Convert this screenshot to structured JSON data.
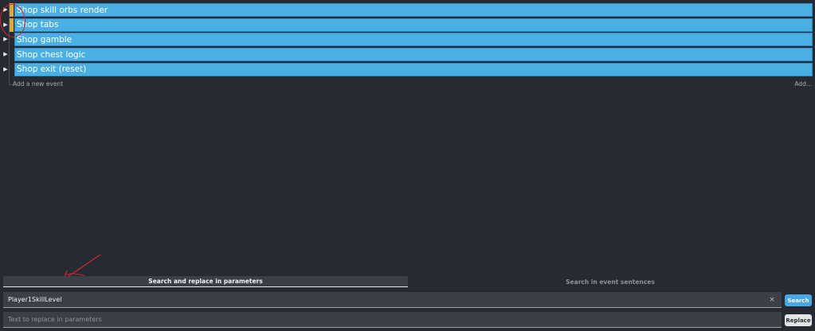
{
  "events": [
    {
      "title": "Shop skill orbs render"
    },
    {
      "title": "Shop tabs"
    },
    {
      "title": "Shop gamble"
    },
    {
      "title": "Shop chest logic"
    },
    {
      "title": "Shop exit (reset)"
    }
  ],
  "add_event": {
    "label": "Add a new event",
    "more_label": "Add..."
  },
  "search_panel": {
    "tabs": [
      {
        "label": "Search and replace in parameters",
        "active": true
      },
      {
        "label": "Search in event sentences",
        "active": false
      }
    ],
    "search_value": "Player1SkillLevel",
    "clear_symbol": "×",
    "search_button": "Search",
    "replace_placeholder": "Text to replace in parameters",
    "replace_button": "Replace"
  },
  "icons": {
    "expand": "triangle-right-icon",
    "clear": "close-icon"
  },
  "colors": {
    "event_bar": "#4ab0e4",
    "background": "#262a33",
    "annotation": "#d0262a",
    "search_button": "#4aa7e6"
  }
}
